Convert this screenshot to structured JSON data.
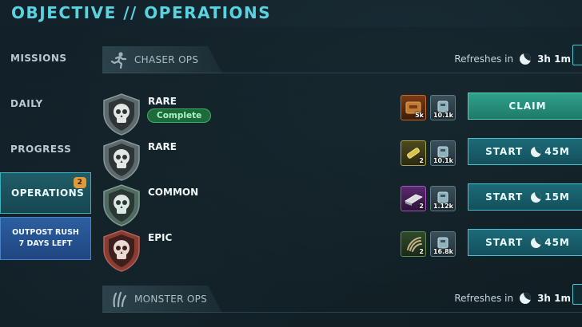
{
  "header": {
    "title": "OBJECTIVE // OPERATIONS"
  },
  "sidebar": {
    "items": [
      {
        "label": "MISSIONS"
      },
      {
        "label": "DAILY"
      },
      {
        "label": "PROGRESS"
      },
      {
        "label": "OPERATIONS",
        "badge": "2",
        "active": true
      }
    ],
    "event": {
      "line1": "OUTPOST RUSH",
      "line2": "7 DAYS LEFT"
    }
  },
  "sections": [
    {
      "label": "CHASER OPS",
      "icon": "running-figure-icon",
      "refresh_label": "Refreshes in",
      "refresh_value": "3h 1m"
    },
    {
      "label": "MONSTER OPS",
      "icon": "claw-icon",
      "refresh_label": "Refreshes in",
      "refresh_value": "3h 1m"
    }
  ],
  "ops": [
    {
      "rarity": "RARE",
      "status": "Complete",
      "reward1_amount": "5k",
      "reward2_amount": "10.1k",
      "action": "CLAIM"
    },
    {
      "rarity": "RARE",
      "reward1_amount": "2",
      "reward2_amount": "10.1k",
      "action": "START",
      "duration": "45M"
    },
    {
      "rarity": "COMMON",
      "reward1_amount": "2",
      "reward2_amount": "1.12k",
      "action": "START",
      "duration": "15M"
    },
    {
      "rarity": "EPIC",
      "reward1_amount": "2",
      "reward2_amount": "16.8k",
      "action": "START",
      "duration": "45M"
    }
  ],
  "colors": {
    "accent": "#58d3df",
    "claim": "#2fa18b",
    "start": "#1c6a78",
    "complete": "#1f6a3b",
    "epic": "#b04a3c"
  }
}
